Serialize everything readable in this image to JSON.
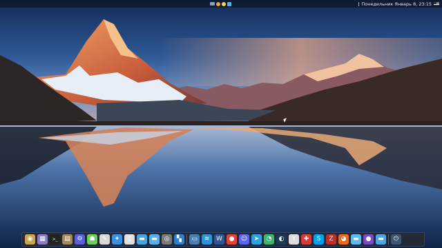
{
  "topbar": {
    "datetime": "Понедельник Январь 8, 23:15",
    "tray_icons": [
      "camera-icon",
      "emoji-icon",
      "vpn-shield-icon",
      "telegram-tray-icon"
    ],
    "flag_icon": "us-flag-icon"
  },
  "dock": {
    "items": [
      {
        "name": "launchpad-icon",
        "glyph": "◉",
        "color": "#c9a44a"
      },
      {
        "name": "gallery-icon",
        "glyph": "▦",
        "color": "#8e7cc3"
      },
      {
        "name": "terminal-icon",
        "glyph": ">_",
        "color": "#222222"
      },
      {
        "name": "archive-icon",
        "glyph": "▤",
        "color": "#a0885a"
      },
      {
        "name": "settings-robot-icon",
        "glyph": "⚙",
        "color": "#5b5fd6"
      },
      {
        "name": "android-icon",
        "glyph": "☗",
        "color": "#6ccf5a"
      },
      {
        "name": "gimp-icon",
        "glyph": "✎",
        "color": "#d9d9d9"
      },
      {
        "name": "safari-icon",
        "glyph": "✦",
        "color": "#3b8fe0"
      },
      {
        "name": "document-viewer-icon",
        "glyph": "▯",
        "color": "#e0e0e0"
      },
      {
        "name": "folder-icon",
        "glyph": "▬",
        "color": "#4aa3df"
      },
      {
        "name": "files-icon",
        "glyph": "▬",
        "color": "#5bb0e8"
      },
      {
        "name": "disk-utility-icon",
        "glyph": "◎",
        "color": "#7a7a7a"
      },
      {
        "name": "app-grid-icon",
        "glyph": "▚",
        "color": "#2f7fd0"
      },
      {
        "name": "sep"
      },
      {
        "name": "screen-recorder-icon",
        "glyph": "▭",
        "color": "#4a7fb5"
      },
      {
        "name": "docker-icon",
        "glyph": "≋",
        "color": "#2a95d8"
      },
      {
        "name": "word-icon",
        "glyph": "W",
        "color": "#2b5797"
      },
      {
        "name": "chrome-icon",
        "glyph": "●",
        "color": "#e34234"
      },
      {
        "name": "discord-icon",
        "glyph": "☺",
        "color": "#5865f2"
      },
      {
        "name": "telegram-icon",
        "glyph": "➤",
        "color": "#2aa3e0"
      },
      {
        "name": "whatsapp-icon",
        "glyph": "◔",
        "color": "#3fb26b"
      },
      {
        "name": "steam-icon",
        "glyph": "◐",
        "color": "#1b3a5a"
      },
      {
        "name": "yandex-icon",
        "glyph": "Y",
        "color": "#dddddd"
      },
      {
        "name": "pdf-icon",
        "glyph": "✚",
        "color": "#d83a3a"
      },
      {
        "name": "skype-icon",
        "glyph": "S",
        "color": "#00a2ed"
      },
      {
        "name": "filezilla-icon",
        "glyph": "Z",
        "color": "#bf2e26"
      },
      {
        "name": "firefox-icon",
        "glyph": "◕",
        "color": "#e66b1f"
      },
      {
        "name": "home-folder-icon",
        "glyph": "▬",
        "color": "#5fb8ee"
      },
      {
        "name": "tor-browser-icon",
        "glyph": "●",
        "color": "#7a4cc4"
      },
      {
        "name": "trash-folder-icon",
        "glyph": "▬",
        "color": "#4fa6df"
      },
      {
        "name": "sep"
      },
      {
        "name": "power-icon",
        "glyph": "⏻",
        "color": "#3e5673"
      }
    ]
  },
  "colors": {
    "sky_top": "#1c3b72",
    "sky_mid": "#3f6aa8",
    "horizon_glow": "#f0a97f",
    "mountain_lit": "#e8824a",
    "lake": "#1d3d6e"
  }
}
